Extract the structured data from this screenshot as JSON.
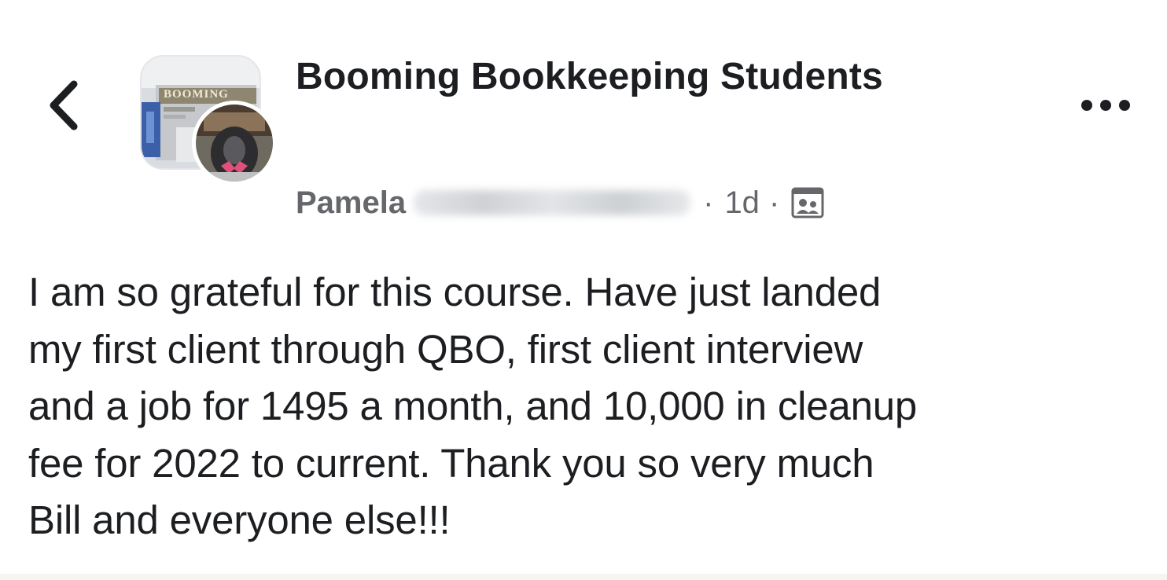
{
  "post": {
    "group_name": "Booming Bookkeeping Students",
    "author_first_name": "Pamela",
    "separator": "·",
    "timestamp": "1d",
    "audience_icon": "group-members-icon",
    "group_avatar_text": "BOOMING",
    "body": "I am so grateful for this course. Have just landed\nmy first client through QBO, first client interview\nand a job for 1495 a month, and 10,000 in cleanup\nfee for 2022 to current. Thank you so very much\nBill and everyone else!!!"
  },
  "icons": {
    "back": "chevron-left-icon",
    "more": "more-options-icon"
  },
  "colors": {
    "text_primary": "#1c1e21",
    "text_secondary": "#65676b",
    "background": "#ffffff"
  }
}
